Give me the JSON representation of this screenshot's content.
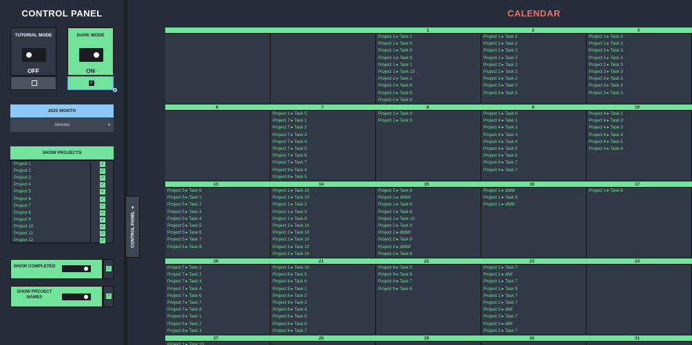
{
  "control_panel": {
    "title": "CONTROL PANEL",
    "tutorial_mode": {
      "label": "TUTORIAL MODE",
      "state": "OFF"
    },
    "dark_mode": {
      "label": "DARK MODE",
      "state": "ON"
    },
    "month_header": "2025 MONTH",
    "month_value": "January",
    "projects_header": "SHOW PROJECTS",
    "projects": [
      "Project 1",
      "Project 2",
      "Project 3",
      "Project 4",
      "Project 5",
      "Project 6",
      "Project 7",
      "Project 8",
      "Project 9",
      "Project 10",
      "Project 11",
      "Project 12"
    ],
    "show_completed": "SHOW COMPLETED",
    "show_project_names": "SHOW PROJECT NAMES",
    "tab_label": "CONTROL PANEL ◄",
    "check_glyph": "✓",
    "caret_glyph": "▼"
  },
  "calendar": {
    "title": "CALENDAR",
    "weeks": [
      {
        "days": [
          {
            "num": "",
            "entries": []
          },
          {
            "num": "",
            "entries": []
          },
          {
            "num": "1",
            "entries": [
              "Project 1 ▸ Task 1",
              "Project 1 ▸ Task 6",
              "Project 1 ▸ Task 9",
              "Project 1 ▸ Task 9",
              "Project 1 ▸ Task 1",
              "Project 1 ▸ Task 10",
              "Project 2 ▸ Task 1",
              "Project 2 ▸ Task 6",
              "Project 2 ▸ Task 9",
              "Project 2 ▸ Task 9"
            ]
          },
          {
            "num": "2",
            "entries": [
              "Project 1 ▸ Task 2",
              "Project 1 ▸ Task 2",
              "Project 1 ▸ Task 2",
              "Project 1 ▸ Task 2",
              "Project 2 ▸ Task 2",
              "Project 2 ▸ Task 2",
              "Project 3 ▸ Task 2",
              "Project 3 ▸ Task 2",
              "Project 3 ▸ Task 2"
            ]
          },
          {
            "num": "3",
            "entries": [
              "Project 1 ▸ Task 3",
              "Project 1 ▸ Task 3",
              "Project 2 ▸ Task 3",
              "Project 2 ▸ Task 3",
              "Project 2 ▸ Task 3",
              "Project 3 ▸ Task 3",
              "Project 3 ▸ Task 3",
              "Project 3 ▸ Task 3",
              "Project 3 ▸ Task 3"
            ]
          }
        ]
      },
      {
        "days": [
          {
            "num": "6",
            "entries": []
          },
          {
            "num": "7",
            "entries": [
              "Project 1 ▸ Task 5",
              "Project 7 ▸ Task 1",
              "Project 7 ▸ Task 2",
              "Project 7 ▸ Task 3",
              "Project 7 ▸ Task 4",
              "Project 7 ▸ Task 5",
              "Project 7 ▸ Task 6",
              "Project 7 ▸ Task 7",
              "Project 9 ▸ Task 4",
              "Project 9 ▸ Task 5"
            ]
          },
          {
            "num": "8",
            "entries": [
              "Project 1 ▸ Task 9",
              "Project 1 ▸ Task 9"
            ]
          },
          {
            "num": "9",
            "entries": [
              "Project 1 ▸ Task 6",
              "Project 4 ▸ Task 1",
              "Project 4 ▸ Task 2",
              "Project 4 ▸ Task 3",
              "Project 4 ▸ Task 4",
              "Project 4 ▸ Task 5",
              "Project 4 ▸ Task 6",
              "Project 4 ▸ Task 7",
              "Project 4 ▸ Task 7"
            ]
          },
          {
            "num": "10",
            "entries": [
              "Project 4 ▸ Task 1",
              "Project 4 ▸ Task 2",
              "Project 4 ▸ Task 3",
              "Project 4 ▸ Task 4",
              "Project 4 ▸ Task 5",
              "Project 4 ▸ Task 6"
            ]
          }
        ]
      },
      {
        "days": [
          {
            "num": "13",
            "entries": [
              "Project 5 ▸ Task 8",
              "Project 5 ▸ Task 1",
              "Project 5 ▸ Task 2",
              "Project 5 ▸ Task 3",
              "Project 5 ▸ Task 4",
              "Project 5 ▸ Task 5",
              "Project 5 ▸ Task 6",
              "Project 5 ▸ Task 7",
              "Project 5 ▸ Task 8"
            ]
          },
          {
            "num": "14",
            "entries": [
              "Project 1 ▸ Task 10",
              "Project 1 ▸ Task 10",
              "Project 1 ▸ Task 2",
              "Project 1 ▸ Task 3",
              "Project 1 ▸ Task 9",
              "Project 2 ▸ Task 10",
              "Project 2 ▸ Task 10",
              "Project 2 ▸ Task 10",
              "Project 2 ▸ Task 10",
              "Project 2 ▸ Task 10"
            ]
          },
          {
            "num": "15",
            "entries": [
              "Project 1 ▸ Task 8",
              "Project 1 ▸ dfdfdf",
              "Project 1 ▸ Task 9",
              "Project 1 ▸ Task 8",
              "Project 1 ▸ Task 10",
              "Project 2 ▸ Task 8",
              "Project 2 ▸ dfdfdf",
              "Project 2 ▸ Task 8",
              "Project 2 ▸ dfdfdf",
              "Project 2 ▸ Task 8"
            ]
          },
          {
            "num": "16",
            "entries": [
              "Project 1 ▸ dfdfd",
              "Project 1 ▸ Task 9",
              "Project 1 ▸ dfdfd"
            ]
          },
          {
            "num": "17",
            "entries": [
              "Project 1 ▸ Task 6"
            ]
          }
        ]
      },
      {
        "days": [
          {
            "num": "20",
            "entries": [
              "Project 7 ▸ Task 1",
              "Project 7 ▸ Task 2",
              "Project 7 ▸ Task 3",
              "Project 7 ▸ Task 4",
              "Project 7 ▸ Task 6",
              "Project 7 ▸ Task 7",
              "Project 7 ▸ Task 8",
              "Project 8 ▸ Task 1",
              "Project 8 ▸ Task 2",
              "Project 8 ▸ Task 3"
            ]
          },
          {
            "num": "21",
            "entries": [
              "Project 1 ▸ Task 10",
              "Project 8 ▸ Task 5",
              "Project 8 ▸ Task 6",
              "Project 8 ▸ Task 1",
              "Project 8 ▸ Task 2",
              "Project 8 ▸ Task 3",
              "Project 8 ▸ Task 4",
              "Project 8 ▸ Task 5",
              "Project 8 ▸ Task 6",
              "Project 8 ▸ Task 7"
            ]
          },
          {
            "num": "22",
            "entries": [
              "Project 9 ▸ Task 5",
              "Project 9 ▸ Task 6",
              "Project 9 ▸ Task 7",
              "Project 9 ▸ Task 8"
            ]
          },
          {
            "num": "23",
            "entries": [
              "Project 1 ▸ Task 7",
              "Project 1 ▸ dfdf",
              "Project 1 ▸ Task 7",
              "Project 1 ▸ Task 9",
              "Project 1 ▸ Task 7",
              "Project 2 ▸ Task 7",
              "Project 2 ▸ dfdf",
              "Project 2 ▸ Task 7",
              "Project 2 ▸ dfdf",
              "Project 2 ▸ Task 7"
            ]
          },
          {
            "num": "24",
            "entries": []
          }
        ]
      },
      {
        "days": [
          {
            "num": "27",
            "entries": [
              "Project 1 ▸ Task 10"
            ]
          },
          {
            "num": "28",
            "entries": []
          },
          {
            "num": "29",
            "entries": []
          },
          {
            "num": "30",
            "entries": []
          },
          {
            "num": "31",
            "entries": []
          }
        ]
      }
    ]
  },
  "colors": {
    "accent": "#71e39a",
    "title_red": "#f07060",
    "month_blue": "#8cc8f5",
    "bg": "#262c38",
    "cell": "#313846"
  }
}
